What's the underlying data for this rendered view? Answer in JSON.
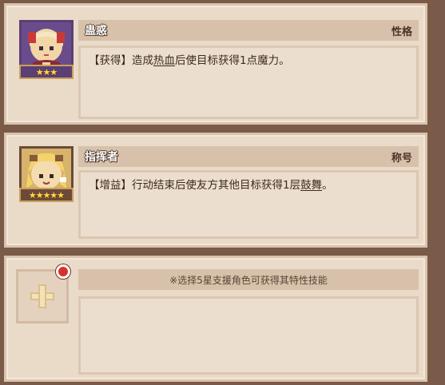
{
  "traits": [
    {
      "name": "蛊惑",
      "type": "性格",
      "star_count": 3,
      "stars": "★★★",
      "desc_prefix": "【获得】造成",
      "desc_kw1": "热血",
      "desc_suffix": "后使目标获得1点魔力。"
    },
    {
      "name": "指挥者",
      "type": "称号",
      "star_count": 5,
      "stars": "★★★★★",
      "desc_prefix": "【增益】行动结束后使友方其他目标获得1层",
      "desc_kw1": "鼓舞",
      "desc_suffix": "。"
    }
  ],
  "support_slot": {
    "hint": "※选择5星支援角色可获得其特性技能",
    "has_notification": true
  }
}
